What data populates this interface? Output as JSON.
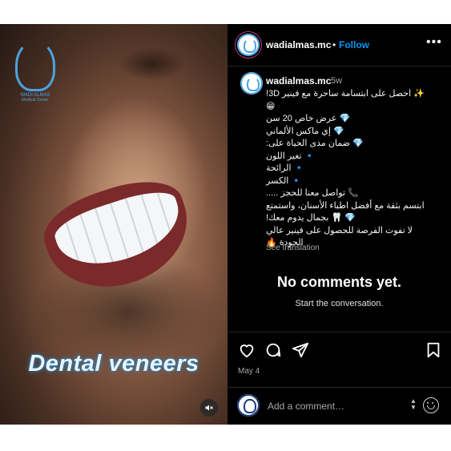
{
  "media": {
    "brand_name": "WADI ALMAS",
    "brand_sub": "Medical Center",
    "overlay_text": "Dental veneers",
    "mute_icon": "speaker-muted-icon"
  },
  "header": {
    "username": "wadialmas.mc",
    "separator": "•",
    "follow_label": "Follow",
    "more_label": "•••"
  },
  "caption": {
    "username": "wadialmas.mc",
    "time_ago": "5w",
    "lines": [
      "✨ احصل على ابتسامة ساحرة مع فينير 3D!",
      "😁",
      "💎 عرض خاص 20 سن",
      "💎 إي ماكس الألماني",
      "💎 ضمان مدى الحياة على:",
      "🔹 تغير اللون",
      "🔹 الرائحة",
      "🔹 الكسر",
      "📞 تواصل معنا للحجز .....",
      "ابتسم بثقة مع أفضل اطباء الأسنان، واستمتع",
      "💎 🦷 بجمال يدوم معك!",
      "لا تفوت الفرصة للحصول على فينير عالي",
      "الجودة 🔥"
    ],
    "see_translation": "See translation"
  },
  "comments": {
    "empty_title": "No comments yet.",
    "empty_subtitle": "Start the conversation."
  },
  "actions": {
    "like_icon": "heart-icon",
    "comment_icon": "comment-icon",
    "share_icon": "share-icon",
    "save_icon": "bookmark-icon",
    "date": "May 4"
  },
  "composer": {
    "placeholder": "Add a comment…",
    "emoji_icon": "emoji-icon"
  },
  "colors": {
    "accent": "#0095f6",
    "brand": "#4aa3df",
    "background": "#000000"
  }
}
